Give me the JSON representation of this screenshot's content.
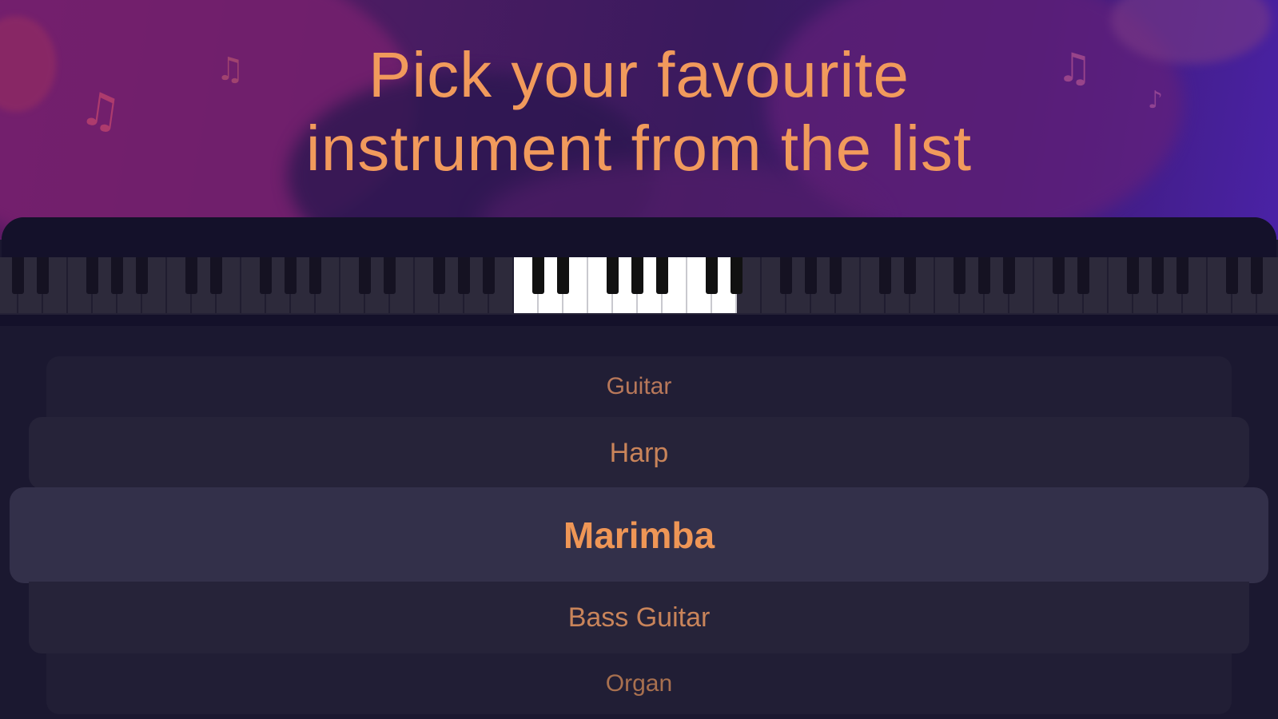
{
  "header": {
    "title_line1": "Pick your favourite",
    "title_line2": "instrument from the list"
  },
  "picker": {
    "items": [
      "Guitar",
      "Harp",
      "Marimba",
      "Bass Guitar",
      "Organ"
    ],
    "selected": "Marimba"
  },
  "colors": {
    "accent": "#f19a5c",
    "panel": "#1b1830",
    "selected_row": "#33304a"
  },
  "icons": [
    "music-note-icon",
    "music-note-icon",
    "music-note-icon",
    "music-note-icon"
  ]
}
